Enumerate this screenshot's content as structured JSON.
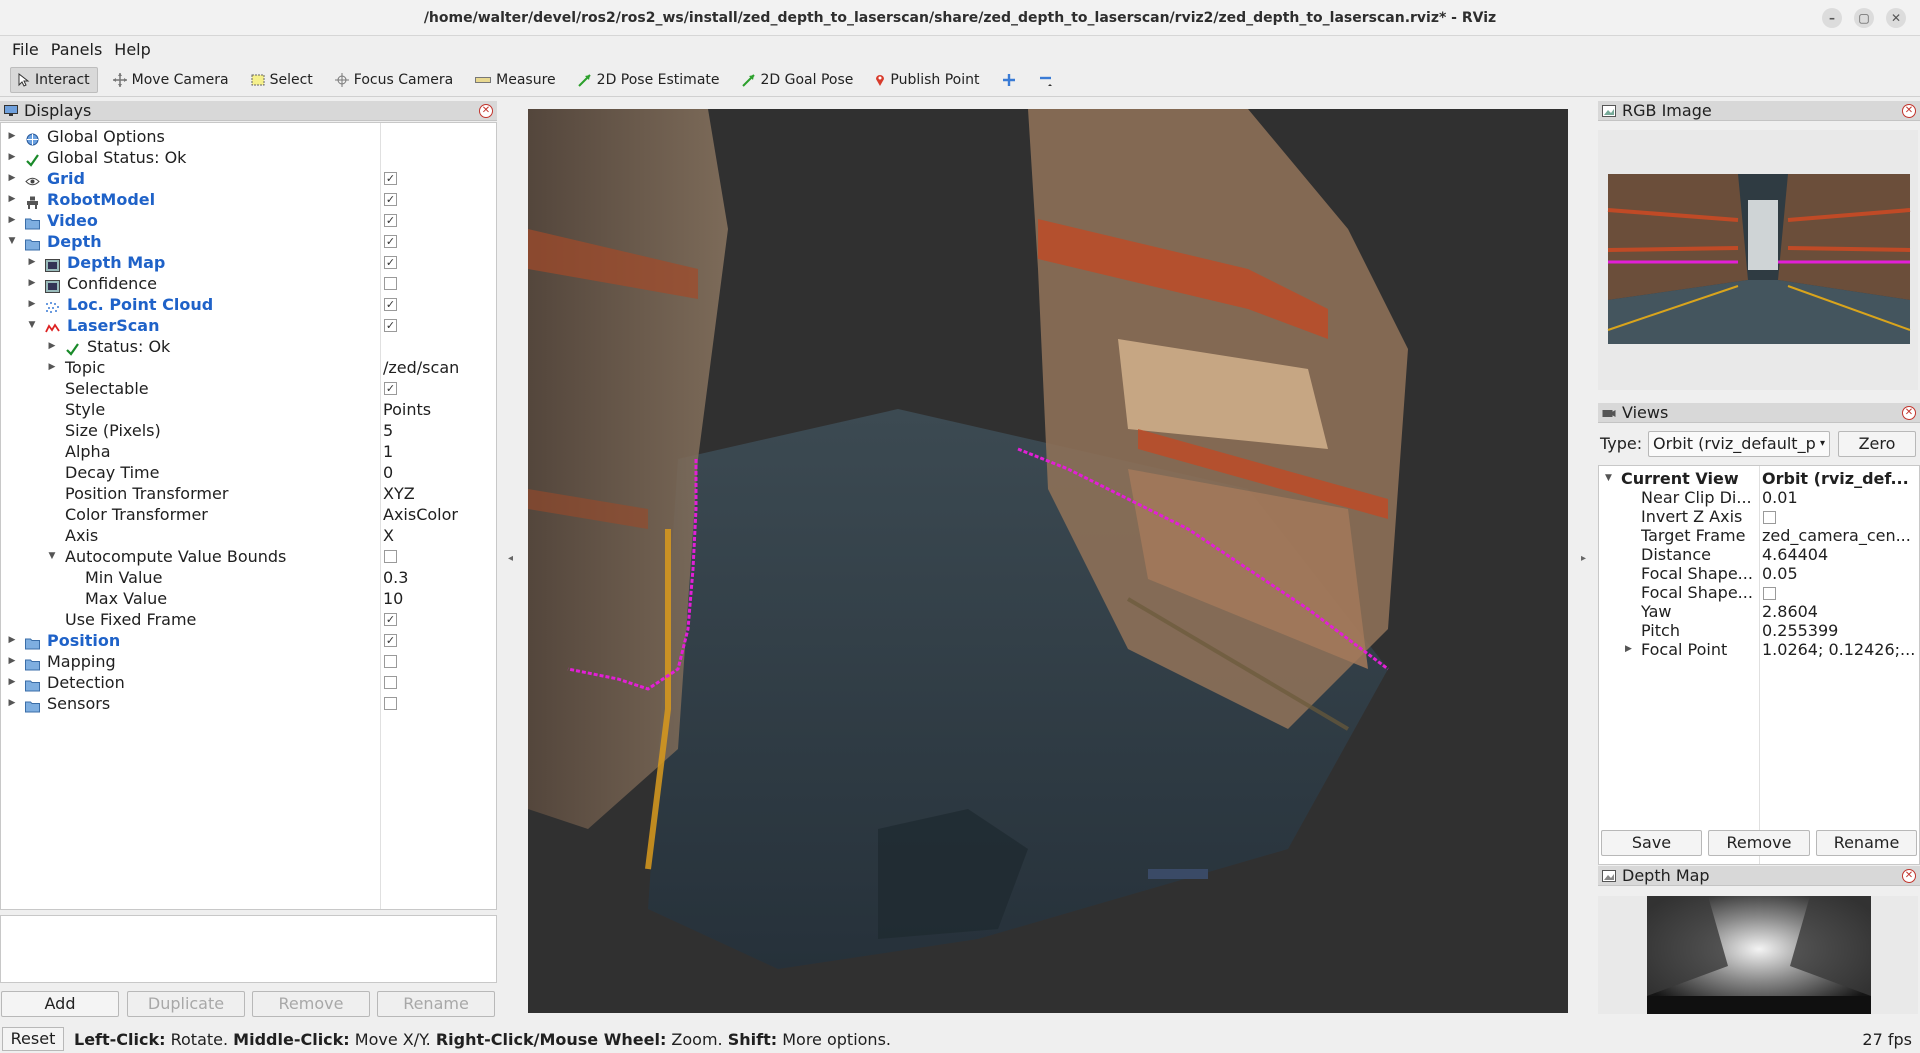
{
  "window": {
    "title": "/home/walter/devel/ros2/ros2_ws/install/zed_depth_to_laserscan/share/zed_depth_to_laserscan/rviz2/zed_depth_to_laserscan.rviz* - RViz"
  },
  "menu": [
    "File",
    "Panels",
    "Help"
  ],
  "toolbar": {
    "interact": "Interact",
    "move_camera": "Move Camera",
    "select": "Select",
    "focus_camera": "Focus Camera",
    "measure": "Measure",
    "pose_estimate": "2D Pose Estimate",
    "goal_pose": "2D Goal Pose",
    "publish_point": "Publish Point"
  },
  "displays": {
    "title": "Displays",
    "rows": [
      {
        "label": "Global Options",
        "value": ""
      },
      {
        "label": "Global Status: Ok",
        "value": ""
      },
      {
        "label": "Grid",
        "value": ""
      },
      {
        "label": "RobotModel",
        "value": ""
      },
      {
        "label": "Video",
        "value": ""
      },
      {
        "label": "Depth",
        "value": ""
      },
      {
        "label": "Depth Map",
        "value": ""
      },
      {
        "label": "Confidence",
        "value": ""
      },
      {
        "label": "Loc. Point Cloud",
        "value": ""
      },
      {
        "label": "LaserScan",
        "value": ""
      },
      {
        "label": "Status: Ok",
        "value": ""
      },
      {
        "label": "Topic",
        "value": "/zed/scan"
      },
      {
        "label": "Selectable",
        "value": ""
      },
      {
        "label": "Style",
        "value": "Points"
      },
      {
        "label": "Size (Pixels)",
        "value": "5"
      },
      {
        "label": "Alpha",
        "value": "1"
      },
      {
        "label": "Decay Time",
        "value": "0"
      },
      {
        "label": "Position Transformer",
        "value": "XYZ"
      },
      {
        "label": "Color Transformer",
        "value": "AxisColor"
      },
      {
        "label": "Axis",
        "value": "X"
      },
      {
        "label": "Autocompute Value Bounds",
        "value": ""
      },
      {
        "label": "Min Value",
        "value": "0.3"
      },
      {
        "label": "Max Value",
        "value": "10"
      },
      {
        "label": "Use Fixed Frame",
        "value": ""
      },
      {
        "label": "Position",
        "value": ""
      },
      {
        "label": "Mapping",
        "value": ""
      },
      {
        "label": "Detection",
        "value": ""
      },
      {
        "label": "Sensors",
        "value": ""
      }
    ],
    "buttons": {
      "add": "Add",
      "duplicate": "Duplicate",
      "remove": "Remove",
      "rename": "Rename"
    }
  },
  "rgb_panel": {
    "title": "RGB Image"
  },
  "views_panel": {
    "title": "Views",
    "type_label": "Type:",
    "type_value": "Orbit (rviz_default_p",
    "zero": "Zero",
    "current_view": {
      "label": "Current View",
      "value": "Orbit (rviz_def..."
    },
    "props": [
      {
        "label": "Near Clip Di...",
        "value": "0.01"
      },
      {
        "label": "Invert Z Axis",
        "value": ""
      },
      {
        "label": "Target Frame",
        "value": "zed_camera_cen..."
      },
      {
        "label": "Distance",
        "value": "4.64404"
      },
      {
        "label": "Focal Shape...",
        "value": "0.05"
      },
      {
        "label": "Focal Shape...",
        "value": ""
      },
      {
        "label": "Yaw",
        "value": "2.8604"
      },
      {
        "label": "Pitch",
        "value": "0.255399"
      },
      {
        "label": "Focal Point",
        "value": "1.0264; 0.12426;..."
      }
    ],
    "buttons": {
      "save": "Save",
      "remove": "Remove",
      "rename": "Rename"
    }
  },
  "depth_panel": {
    "title": "Depth Map"
  },
  "status": {
    "reset": "Reset",
    "h1k": "Left-Click:",
    "h1v": " Rotate. ",
    "h2k": "Middle-Click:",
    "h2v": " Move X/Y. ",
    "h3k": "Right-Click/Mouse Wheel:",
    "h3v": " Zoom. ",
    "h4k": "Shift:",
    "h4v": " More options.",
    "fps": "27 fps"
  },
  "colors": {
    "accent_blue": "#1f62c8",
    "close_red": "#c2342c",
    "laser_magenta": "#e21fd6"
  }
}
